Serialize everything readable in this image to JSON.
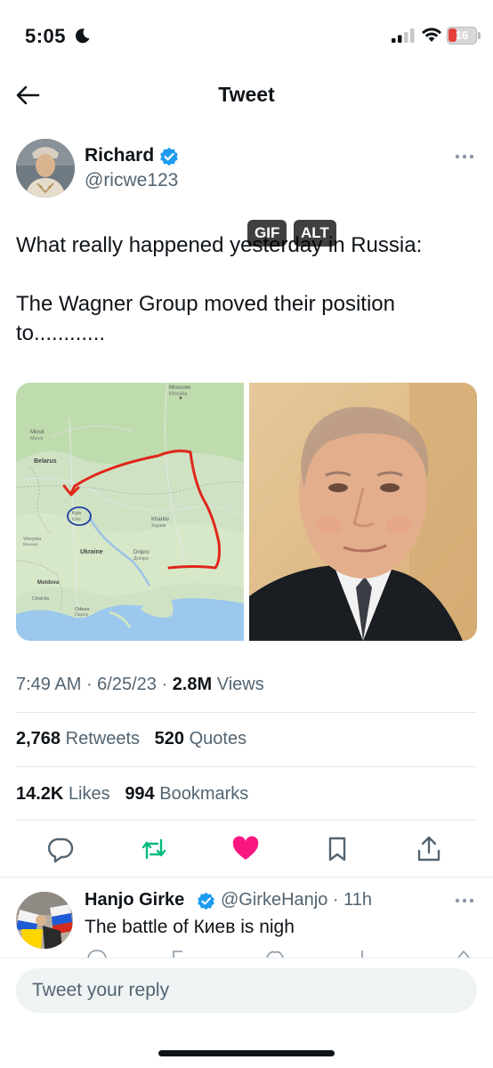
{
  "status_bar": {
    "time": "5:05",
    "battery_level": "16"
  },
  "header": {
    "title": "Tweet"
  },
  "tweet": {
    "author_name": "Richard",
    "author_handle": "@ricwe123",
    "text": "What really happened yesterday in Russia:\n\nThe Wagner Group moved their position to............",
    "media": {
      "map_labels": {
        "moscow": "Moscow",
        "moscow_cyr": "Москва",
        "minsk": "Minsk",
        "minsk_cyr": "Мінск",
        "belarus": "Belarus",
        "kyiv": "Kyiv",
        "kyiv_cyr": "Київ",
        "kharkiv": "Kharkiv",
        "kharkiv_cyr": "Харків",
        "vinnytsia": "Vinnytsia",
        "vinnytsia_cyr": "Вінниця",
        "ukraine": "Ukraine",
        "dnipro": "Dnipro",
        "dnipro_cyr": "Дніпро",
        "moldova": "Moldova",
        "chisinau": "Chișinău",
        "odesa": "Odesa",
        "odesa_cyr": "Одеса"
      },
      "gif_badge": "GIF",
      "alt_badge": "ALT"
    },
    "time": "7:49 AM",
    "date": "6/25/23",
    "views_count": "2.8M",
    "views_label": "Views",
    "retweets_count": "2,768",
    "retweets_label": "Retweets",
    "quotes_count": "520",
    "quotes_label": "Quotes",
    "likes_count": "14.2K",
    "likes_label": "Likes",
    "bookmarks_count": "994",
    "bookmarks_label": "Bookmarks"
  },
  "colors": {
    "verified": "#1d9bf0",
    "retweet": "#00ba7c",
    "like": "#f91880",
    "secondary_text": "#536471",
    "route_line": "#e0261b"
  },
  "icons": [
    "back-arrow-icon",
    "verified-icon",
    "more-icon",
    "reply-icon",
    "retweet-icon",
    "like-icon",
    "bookmark-icon",
    "share-icon",
    "signal-icon",
    "wifi-icon",
    "battery-icon",
    "moon-icon"
  ],
  "reply": {
    "author_name": "Hanjo Girke",
    "author_handle": "@GirkeHanjo",
    "time": "11h",
    "text": "The battle of Киев is nigh"
  },
  "composer": {
    "placeholder": "Tweet your reply"
  }
}
